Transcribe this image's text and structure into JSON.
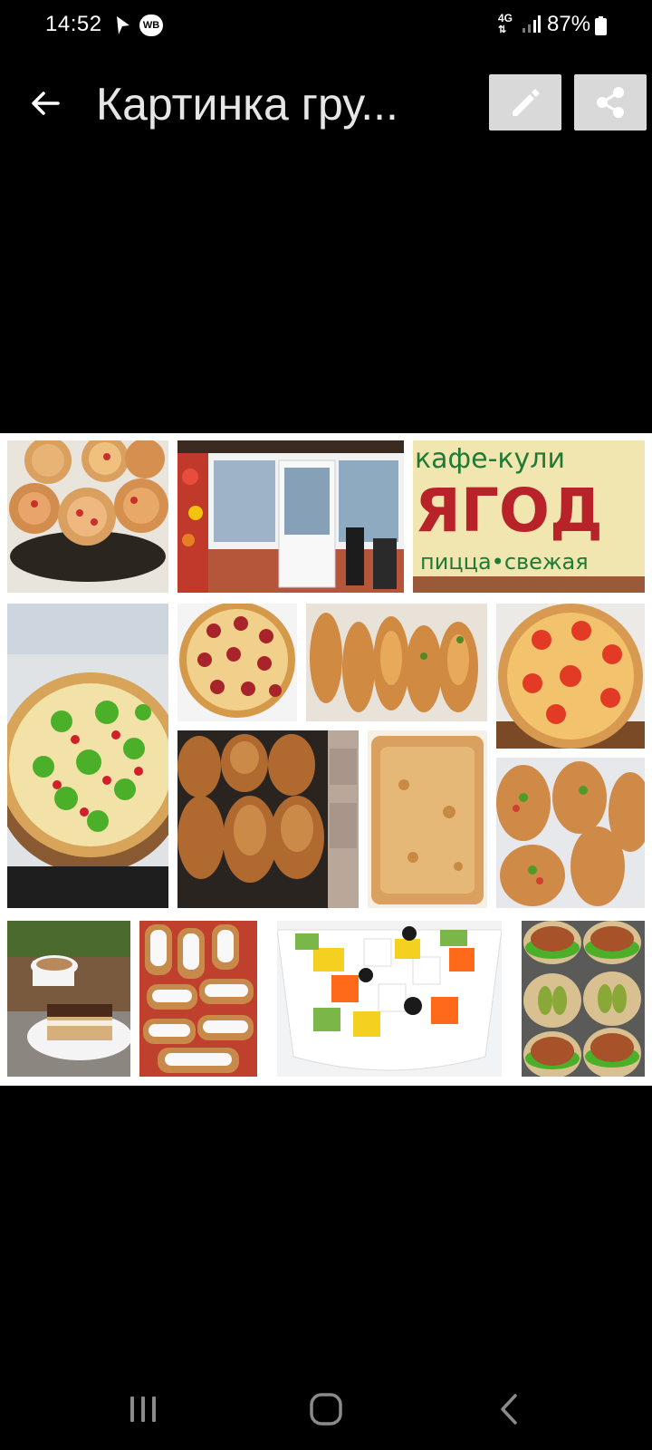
{
  "status_bar": {
    "time": "14:52",
    "wb_badge": "WB",
    "network": "4G",
    "battery": "87%"
  },
  "toolbar": {
    "title": "Картинка гру..."
  },
  "collage": {
    "sign_line1": "кафе-кули",
    "sign_line2": "ЯГОД",
    "sign_line3": "пицца•свежая"
  },
  "icons": {
    "back": "arrow-left-icon",
    "edit": "pencil-icon",
    "share": "share-icon",
    "recents": "recents-icon",
    "home": "home-icon",
    "nav_back": "chevron-left-icon"
  },
  "colors": {
    "background": "#000000",
    "toolbar_button": "#d9d9d9",
    "title_text": "#e6e6e6",
    "collage_frame": "#ffffff"
  }
}
